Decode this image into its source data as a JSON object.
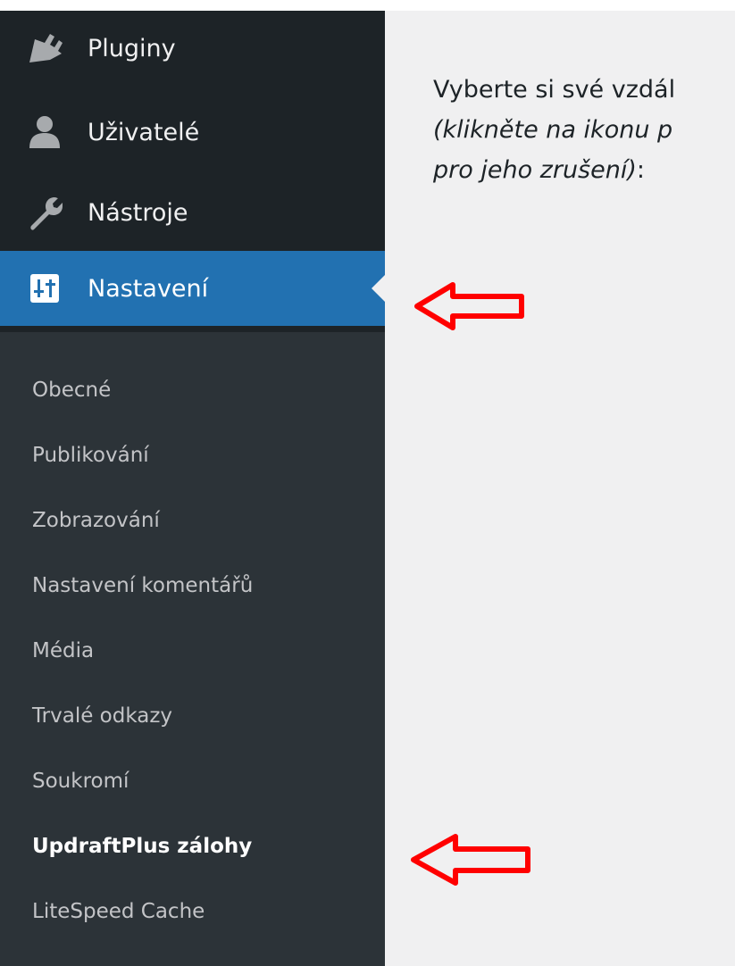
{
  "menu": {
    "items": [
      {
        "label": "Pluginy",
        "icon": "plug-icon"
      },
      {
        "label": "Uživatelé",
        "icon": "user-icon"
      },
      {
        "label": "Nástroje",
        "icon": "wrench-icon"
      },
      {
        "label": "Nastavení",
        "icon": "settings-sliders-icon",
        "active": true
      }
    ]
  },
  "submenu": {
    "items": [
      {
        "label": "Obecné"
      },
      {
        "label": "Publikování"
      },
      {
        "label": "Zobrazování"
      },
      {
        "label": "Nastavení komentářů"
      },
      {
        "label": "Média"
      },
      {
        "label": "Trvalé odkazy"
      },
      {
        "label": "Soukromí"
      },
      {
        "label": "UpdraftPlus zálohy",
        "current": true
      },
      {
        "label": "LiteSpeed Cache"
      }
    ]
  },
  "content": {
    "line1": "Vyberte si své vzdál",
    "line2": "(klikněte na ikonu p",
    "line3_italic": "pro jeho zrušení)",
    "line3_rest": ":"
  },
  "colors": {
    "sidebar_bg": "#1d2327",
    "submenu_bg": "#2c3338",
    "active_bg": "#2271b1",
    "content_bg": "#f0f0f1",
    "annotation_arrow": "#ff0000"
  }
}
